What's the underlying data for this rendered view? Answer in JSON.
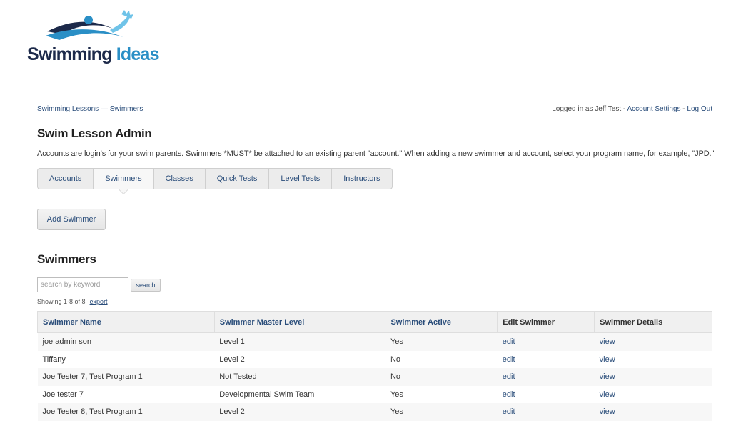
{
  "logo": {
    "word1": "Swimming",
    "word2": "Ideas",
    "brand_dark": "#1d2a4a",
    "brand_blue": "#2a8fc6"
  },
  "breadcrumb": {
    "item1": "Swimming Lessons",
    "separator": "—",
    "item2": "Swimmers"
  },
  "userbar": {
    "prefix": "Logged in as Jeff Test - ",
    "account_settings": "Account Settings",
    "sep": " - ",
    "logout": "Log Out"
  },
  "page_title": "Swim Lesson Admin",
  "intro": "Accounts are login's for your swim parents. Swimmers *MUST* be attached to an existing parent \"account.\" When adding a new swimmer and account, select your program name, for example, \"JPD.\"",
  "tabs": [
    {
      "label": "Accounts"
    },
    {
      "label": "Swimmers"
    },
    {
      "label": "Classes"
    },
    {
      "label": "Quick Tests"
    },
    {
      "label": "Level Tests"
    },
    {
      "label": "Instructors"
    }
  ],
  "active_tab": "Swimmers",
  "add_button": "Add Swimmer",
  "section_title": "Swimmers",
  "search": {
    "placeholder": "search by keyword",
    "button": "search"
  },
  "showing": {
    "text": "Showing 1-8 of 8",
    "export": "export"
  },
  "table": {
    "headers": [
      "Swimmer Name",
      "Swimmer Master Level",
      "Swimmer Active",
      "Edit Swimmer",
      "Swimmer Details"
    ],
    "rows": [
      {
        "name": "joe admin son",
        "level": "Level 1",
        "active": "Yes",
        "edit": "edit",
        "view": "view"
      },
      {
        "name": "Tiffany",
        "level": "Level 2",
        "active": "No",
        "edit": "edit",
        "view": "view"
      },
      {
        "name": "Joe Tester 7, Test Program 1",
        "level": "Not Tested",
        "active": "No",
        "edit": "edit",
        "view": "view"
      },
      {
        "name": "Joe tester 7",
        "level": "Developmental Swim Team",
        "active": "Yes",
        "edit": "edit",
        "view": "view"
      },
      {
        "name": "Joe Tester 8, Test Program 1",
        "level": "Level 2",
        "active": "Yes",
        "edit": "edit",
        "view": "view"
      }
    ]
  }
}
